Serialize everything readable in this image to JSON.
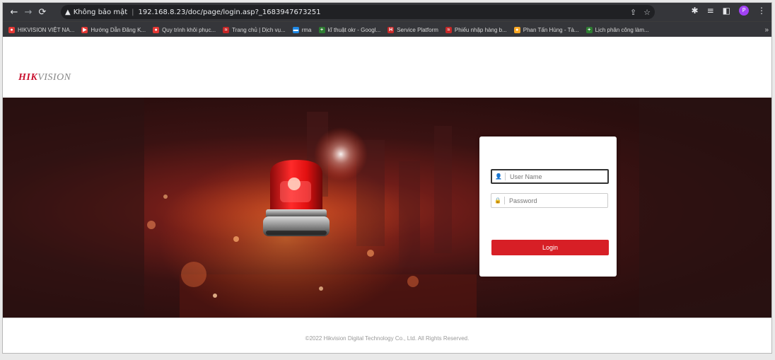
{
  "browser": {
    "back_icon": "arrow-left-icon",
    "forward_icon": "arrow-right-icon",
    "reload_icon": "reload-icon",
    "security_label": "Không bảo mật",
    "url": "192.168.8.23/doc/page/login.asp?_1683947673251",
    "profile_initial": "P"
  },
  "bookmarks": [
    {
      "label": "HIKVISION VIỆT NA...",
      "icon_color": "#e53935",
      "glyph": "●"
    },
    {
      "label": "Hướng Dẫn Đăng K...",
      "icon_color": "#e53935",
      "glyph": "▶"
    },
    {
      "label": "Quy trình khôi phục...",
      "icon_color": "#e53935",
      "glyph": "●"
    },
    {
      "label": "Trang chủ | Dịch vụ...",
      "icon_color": "#c62828",
      "glyph": "≈"
    },
    {
      "label": "rma",
      "icon_color": "#1e88e5",
      "glyph": "▬"
    },
    {
      "label": "kĩ thuật okr - Googl...",
      "icon_color": "#2e7d32",
      "glyph": "+"
    },
    {
      "label": "Service Platform",
      "icon_color": "#c62828",
      "glyph": "H"
    },
    {
      "label": "Phiếu nhập hàng b...",
      "icon_color": "#c62828",
      "glyph": "≈"
    },
    {
      "label": "Phan Tấn Hùng - Tà...",
      "icon_color": "#f9a825",
      "glyph": "●"
    },
    {
      "label": "Lịch phân công làm...",
      "icon_color": "#2e7d32",
      "glyph": "+"
    }
  ],
  "bookmarks_more": "»",
  "page": {
    "logo_red": "HIK",
    "logo_gray": "VISION",
    "copyright": "©2022 Hikvision Digital Technology Co., Ltd. All Rights Reserved."
  },
  "login": {
    "username_placeholder": "User Name",
    "password_placeholder": "Password",
    "button_label": "Login"
  }
}
